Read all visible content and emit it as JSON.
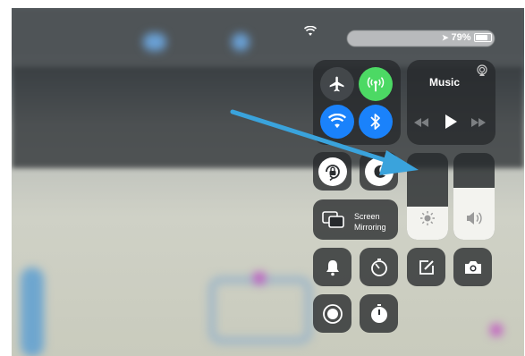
{
  "status_bar": {
    "wifi_icon": "wifi-icon",
    "battery_percent": "79%",
    "location_icon": "location-arrow-icon"
  },
  "connectivity": {
    "airplane": {
      "icon": "airplane-icon",
      "on": false
    },
    "cellular": {
      "icon": "cellular-antenna-icon",
      "on": true,
      "color": "#4cd964"
    },
    "wifi": {
      "icon": "wifi-icon",
      "on": true,
      "color": "#1a82fb"
    },
    "bluetooth": {
      "icon": "bluetooth-icon",
      "on": true,
      "color": "#1a82fb"
    }
  },
  "music": {
    "title": "Music",
    "airplay_icon": "airplay-icon",
    "rewind_icon": "rewind-icon",
    "play_icon": "play-icon",
    "forward_icon": "fast-forward-icon"
  },
  "controls": {
    "orientation_lock": {
      "icon": "rotation-lock-icon"
    },
    "do_not_disturb": {
      "icon": "moon-icon"
    },
    "screen_mirroring": {
      "label_line1": "Screen",
      "label_line2": "Mirroring",
      "icon": "screen-mirroring-icon"
    }
  },
  "brightness": {
    "icon": "sun-icon",
    "level": 0.38
  },
  "volume": {
    "icon": "speaker-icon",
    "level": 0.6
  },
  "shortcuts": [
    {
      "name": "alarm",
      "icon": "bell-icon"
    },
    {
      "name": "timer",
      "icon": "timer-icon"
    },
    {
      "name": "notes",
      "icon": "note-edit-icon"
    },
    {
      "name": "camera",
      "icon": "camera-icon"
    },
    {
      "name": "screen-record",
      "icon": "record-icon"
    },
    {
      "name": "stopwatch",
      "icon": "stopwatch-icon"
    }
  ],
  "annotation": {
    "arrow_color": "#3aa3dc",
    "arrow_icon": "pointer-arrow"
  }
}
